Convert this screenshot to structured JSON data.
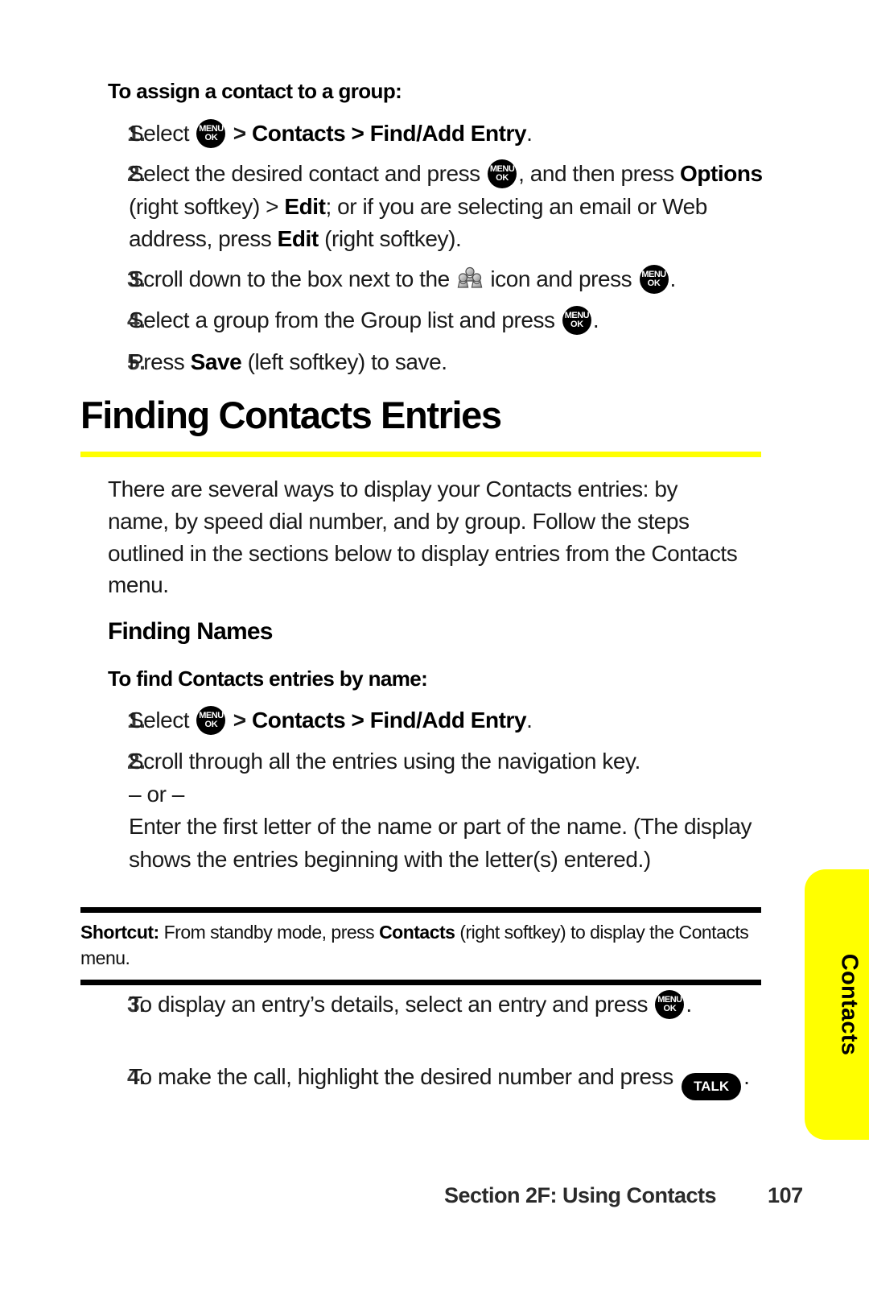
{
  "page": {
    "accent_yellow": "#FFFF00",
    "background": "#FFFFFF",
    "text_color": "#1A1A1A"
  },
  "side_tab": {
    "label": "Contacts"
  },
  "section_assign": {
    "heading": "To assign a contact to a group:",
    "steps": [
      {
        "number": "1.",
        "pre": "Select ",
        "key": "MENU/OK",
        "post_plain": " > ",
        "bold1": "Contacts",
        "mid": " > ",
        "bold2": "Find/Add Entry",
        "tail": "."
      },
      {
        "number": "2.",
        "line1_pre": "Select the desired contact and press ",
        "line1_key": "MENU/OK",
        "line1_post": ", and then press ",
        "line2_bold1": "Options",
        "line2_mid1": " (right softkey) > ",
        "line2_bold2": "Edit",
        "line2_mid2": "; or if you are selecting an email or Web address, press ",
        "line2_bold3": "Edit",
        "line2_tail": " (right softkey)."
      },
      {
        "number": "3.",
        "pre": "Scroll down to the box next to the ",
        "icon": "group-icon",
        "mid": " icon and press ",
        "key": "MENU/OK",
        "tail": "."
      },
      {
        "number": "4.",
        "pre": "Select a group from the Group list and press ",
        "key": "MENU/OK",
        "tail": "."
      },
      {
        "number": "5.",
        "pre": "Press ",
        "bold1": "Save",
        "tail": " (left softkey) to save."
      }
    ]
  },
  "section_finding": {
    "title": "Finding Contacts Entries",
    "intro": "There are several ways to display your Contacts entries: by name, by speed dial number, and by group. Follow the steps outlined in the sections below to display entries from the Contacts menu.",
    "subsection_title": "Finding Names",
    "subheading": "To find Contacts entries by name:",
    "steps_before_callout": [
      {
        "number": "1.",
        "pre": "Select ",
        "key": "MENU/OK",
        "post_plain": " > ",
        "bold1": "Contacts",
        "mid": " > ",
        "bold2": "Find/Add Entry",
        "tail": "."
      },
      {
        "number": "2.",
        "line1": "Scroll through all the entries using the navigation key.",
        "line2": "– or –",
        "line3": "Enter the first letter of the name or part of the name. (The display shows the entries beginning with the letter(s) entered.)"
      }
    ],
    "callout": {
      "label": "Shortcut:",
      "text_pre": " From standby mode, press ",
      "bold": "Contacts",
      "text_post": " (right softkey) to display the Contacts menu."
    },
    "steps_after_callout": [
      {
        "number": "3.",
        "pre": "To display an entry’s details, select an entry and press ",
        "key": "MENU/OK",
        "tail": "."
      },
      {
        "number": "4.",
        "pre": "To make the call, highlight the desired number and press ",
        "key": "TALK",
        "tail": "."
      }
    ]
  },
  "footer": {
    "section": "Section 2F: Using Contacts",
    "page_number": "107"
  },
  "icons": {
    "menu_ok_line1": "MENU",
    "menu_ok_line2": "OK",
    "talk_label": "TALK",
    "group_icon_name": "group-icon"
  }
}
